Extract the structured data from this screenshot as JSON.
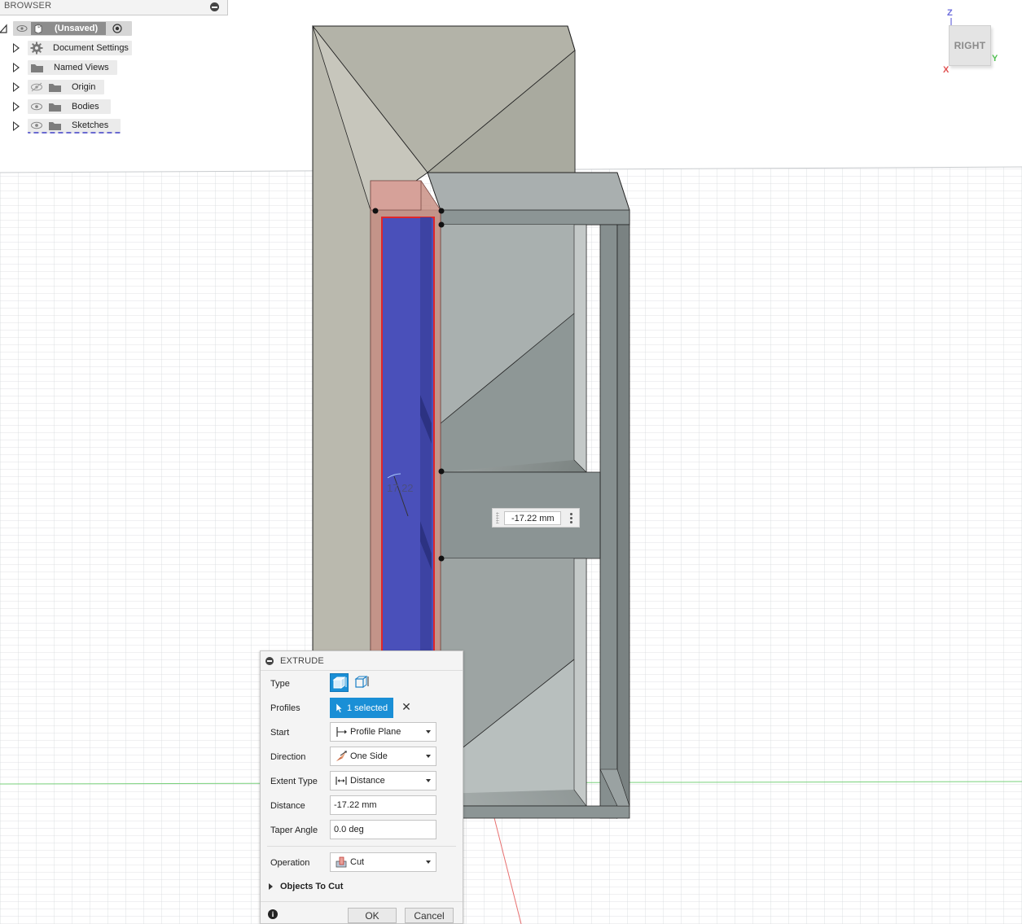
{
  "browser": {
    "title": "BROWSER",
    "root": {
      "label": "(Unsaved)"
    },
    "items": [
      {
        "label": "Document Settings",
        "icon": "gear-icon"
      },
      {
        "label": "Named Views",
        "icon": "folder-icon"
      },
      {
        "label": "Origin",
        "icon": "folder-icon",
        "visibility": "hidden"
      },
      {
        "label": "Bodies",
        "icon": "folder-icon",
        "visibility": "visible"
      },
      {
        "label": "Sketches",
        "icon": "folder-icon",
        "visibility": "visible"
      }
    ]
  },
  "viewcube": {
    "face": "RIGHT",
    "axes": {
      "z": "Z",
      "x": "X",
      "y": "Y"
    }
  },
  "canvas": {
    "sketch_dimension_text": "17.22"
  },
  "manipulator": {
    "value": "-17.22 mm"
  },
  "extrude_dialog": {
    "title": "EXTRUDE",
    "type": {
      "label": "Type",
      "selected": "solid"
    },
    "profiles": {
      "label": "Profiles",
      "value": "1 selected"
    },
    "start": {
      "label": "Start",
      "value": "Profile Plane"
    },
    "direction": {
      "label": "Direction",
      "value": "One Side"
    },
    "extent_type": {
      "label": "Extent Type",
      "value": "Distance"
    },
    "distance": {
      "label": "Distance",
      "value": "-17.22 mm"
    },
    "taper_angle": {
      "label": "Taper Angle",
      "value": "0.0 deg"
    },
    "operation": {
      "label": "Operation",
      "value": "Cut"
    },
    "objects_to_cut": {
      "label": "Objects To Cut"
    },
    "ok_label": "OK",
    "cancel_label": "Cancel"
  },
  "colors": {
    "accent": "#1a8fd6",
    "selected_profile": "#4a52b8",
    "profile_outline": "#e0262a",
    "cut_preview": "#c98f86",
    "body_face": "#bbbcb1",
    "body_dark": "#7d8585",
    "grid_line": "#d9dcde",
    "axis_x": "#e04040",
    "axis_y": "#40c040"
  }
}
